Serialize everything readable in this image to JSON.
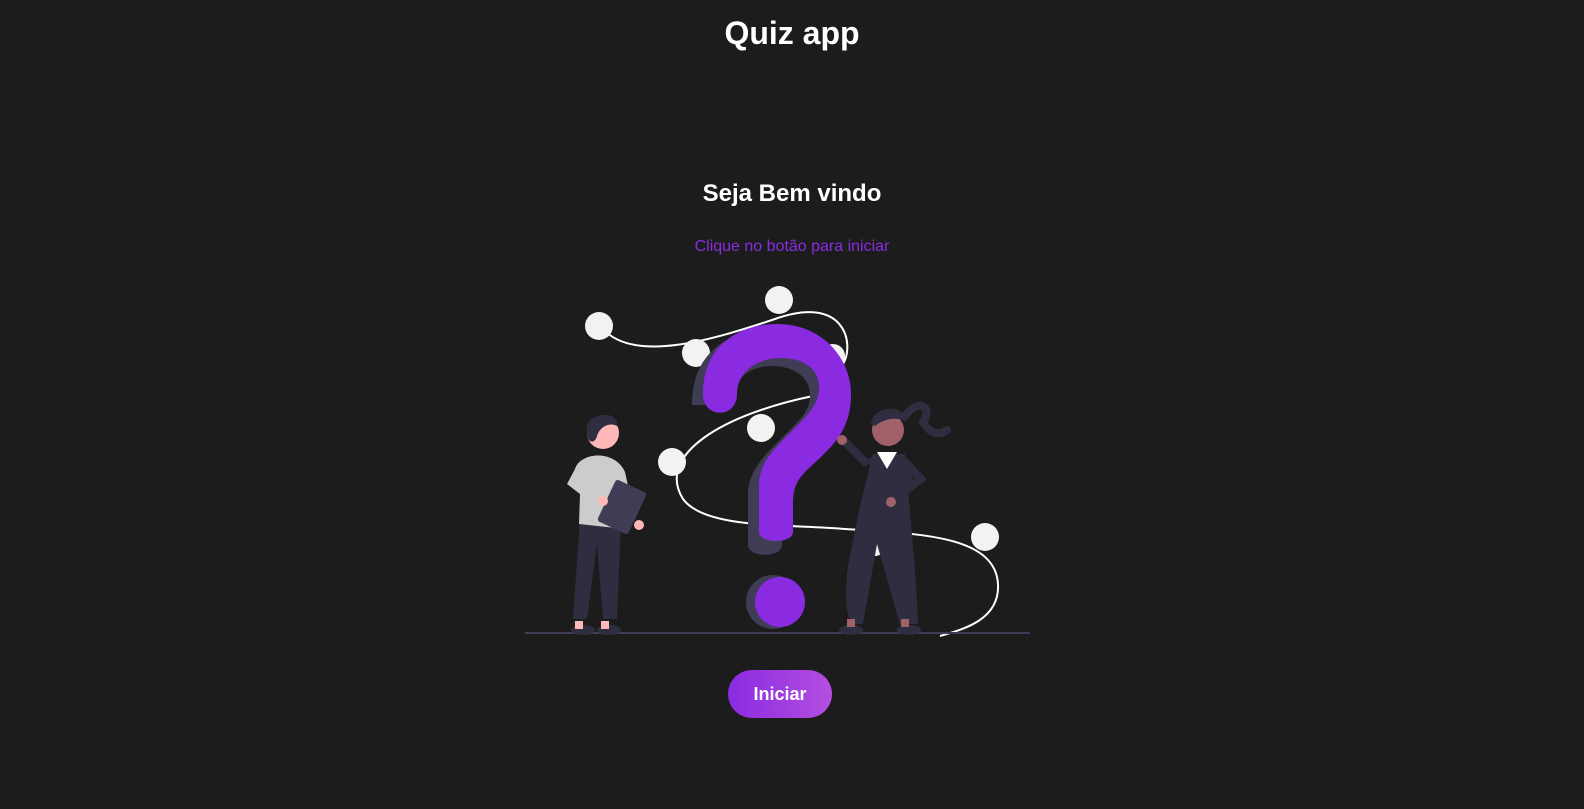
{
  "header": {
    "title": "Quiz app"
  },
  "welcome": {
    "title": "Seja Bem vindo",
    "subtitle": "Clique no botão para iniciar"
  },
  "illustration": {
    "icon": "question-mark-people-illustration",
    "colors": {
      "accent": "#8a2be2",
      "accent_shadow": "#3f3d56",
      "dots": "#f2f2f2",
      "figure_dark": "#2f2e41",
      "skin_light": "#ffb8b8",
      "skin_dark": "#a0616a",
      "shirt": "#cccccc"
    }
  },
  "actions": {
    "start_label": "Iniciar"
  },
  "theme": {
    "background": "#1c1c1c",
    "text": "#ffffff",
    "accent": "#8a2be2",
    "accent_light": "#b44ee0"
  }
}
